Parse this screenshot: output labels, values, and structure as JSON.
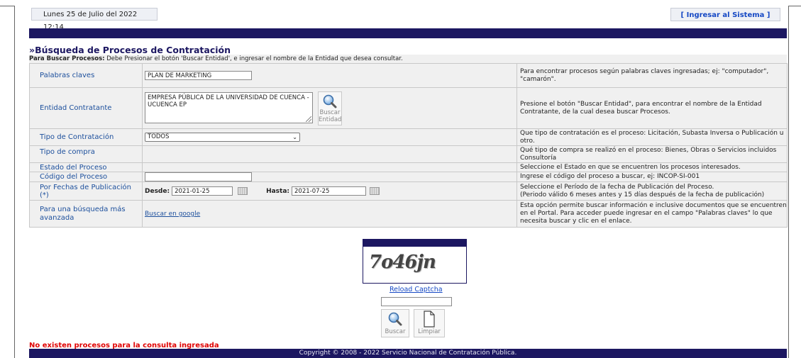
{
  "header": {
    "date": "Lunes 25 de Julio del 2022 12:14",
    "login_link": "[ Ingresar al Sistema ]"
  },
  "section": {
    "title": "»Búsqueda de Procesos de Contratación",
    "instructions_bold": "Para Buscar Procesos:",
    "instructions": " Debe Presionar el botón 'Buscar Entidad', e ingresar el nombre de la Entidad que desea consultar."
  },
  "form": {
    "keywords": {
      "label": "Palabras claves",
      "value": "PLAN DE MARKETING",
      "help": "Para encontrar procesos según palabras claves ingresadas; ej: \"computador\", \"camarón\"."
    },
    "entity": {
      "label": "Entidad Contratante",
      "value": "EMPRESA PÚBLICA DE LA UNIVERSIDAD DE CUENCA - UCUENCA EP",
      "button_line1": "Buscar",
      "button_line2": "Entidad",
      "help": "Presione el botón \"Buscar Entidad\", para encontrar el nombre de la Entidad Contratante, de la cual desea buscar Procesos."
    },
    "contract_type": {
      "label": "Tipo de Contratación",
      "selected": "TODOS",
      "help": "Que tipo de contratación es el proceso: Licitación, Subasta Inversa o Publicación u otro."
    },
    "purchase_type": {
      "label": "Tipo de compra",
      "help": "Qué tipo de compra se realizó en el proceso: Bienes, Obras o Servicios incluidos Consultoría"
    },
    "process_state": {
      "label": "Estado del Proceso",
      "help": "Seleccione el Estado en que se encuentren los procesos interesados."
    },
    "process_code": {
      "label": "Código del Proceso",
      "value": "",
      "help": "Ingrese el código del proceso a buscar, ej: INCOP-SI-001"
    },
    "dates": {
      "label": "Por Fechas de Publicación (*)",
      "from_label": "Desde:",
      "from_value": "2021-01-25",
      "to_label": "Hasta:",
      "to_value": "2021-07-25",
      "help_line1": "Seleccione el Período de la fecha de Publicación del Proceso.",
      "help_line2": "(Periodo válido 6 meses antes y 15 días después de la fecha de publicación)"
    },
    "advanced": {
      "label": "Para una búsqueda más avanzada",
      "link": "Buscar en google",
      "help": "Esta opción permite buscar información e inclusive documentos que se encuentren en el Portal. Para acceder puede ingresar en el campo \"Palabras claves\" lo que necesita buscar y clic en el enlace."
    }
  },
  "captcha": {
    "image_text": "7o46jn",
    "reload": "Reload Captcha",
    "input_value": ""
  },
  "actions": {
    "search": "Buscar",
    "clear": "Limpiar"
  },
  "messages": {
    "no_results": "No existen procesos para la consulta ingresada"
  },
  "footer": {
    "copyright": "Copyright © 2008 - 2022 Servicio Nacional de Contratación Pública."
  }
}
